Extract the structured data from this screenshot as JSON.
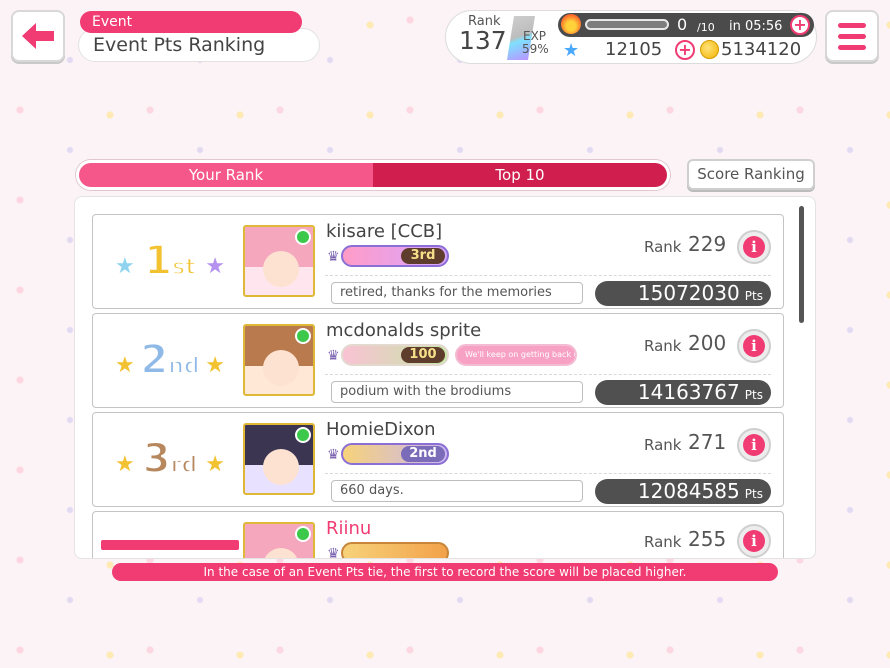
{
  "header": {
    "section_tag": "Event",
    "title": "Event Pts Ranking"
  },
  "status": {
    "rank_label": "Rank",
    "rank_value": "137",
    "exp_label": "EXP",
    "exp_percent": "59%",
    "stamina_value": "0",
    "stamina_max": "/10",
    "stamina_timer": "in 05:56",
    "star_count": "12105",
    "coin_count": "5134120",
    "plus_glyph": "+"
  },
  "tabs": {
    "your_rank": "Your Rank",
    "top10": "Top 10",
    "score_ranking": "Score Ranking"
  },
  "rank_prefix": "Rank",
  "pts_unit": "Pts",
  "entries": [
    {
      "place_num": "1",
      "place_suffix": "st",
      "name": "kiisare [CCB]",
      "badge_num": "3rd",
      "rank": "229",
      "comment": "retired, thanks for the memories",
      "points": "15072030"
    },
    {
      "place_num": "2",
      "place_suffix": "nd",
      "name": "mcdonalds sprite",
      "badge_num": "100",
      "badge2_text": "We'll keep on getting back up",
      "rank": "200",
      "comment": "podium with the brodiums",
      "points": "14163767"
    },
    {
      "place_num": "3",
      "place_suffix": "rd",
      "name": "HomieDixon",
      "badge_num": "2nd",
      "rank": "271",
      "comment": "660 days.",
      "points": "12084585"
    },
    {
      "name": "Riinu",
      "rank": "255"
    }
  ],
  "colors": {
    "accent": "#f03c73",
    "gold": "#f2c230",
    "silver": "#8fb9e6",
    "bronze": "#b7875e"
  },
  "footer_note": "In the case of an Event Pts tie, the first to record the score will be placed higher."
}
